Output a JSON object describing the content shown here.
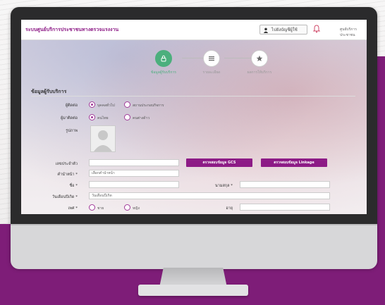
{
  "header": {
    "app_title": "ระบบศูนย์บริการประชาชนทางตรวจแรงงาน",
    "user_button": "ไปยังบัญชีผู้ใช้",
    "right_text": "ศูนย์บริการประชาชน"
  },
  "steps": [
    {
      "label": "ข้อมูลผู้รับบริการ",
      "icon": "lock-icon",
      "state": "active"
    },
    {
      "label": "รายละเอียด",
      "icon": "list-icon",
      "state": "inactive"
    },
    {
      "label": "ผลการให้บริการ",
      "icon": "star-icon",
      "state": "inactive"
    }
  ],
  "form": {
    "section_title": "ข้อมูลผู้รับบริการ",
    "row1": {
      "label": "ผู้ติดต่อ",
      "opt1": "บุคคลทั่วไป",
      "opt2": "สถานประกอบกิจการ"
    },
    "row2": {
      "label": "ผู้มาติดต่อ",
      "opt1": "คนไทย",
      "opt2": "คนต่างด้าว"
    },
    "photo_label": "รูปภาพ",
    "id_label": "เลขประจำตัว",
    "btn_gcs": "ตรวจสอบข้อมูล GCS",
    "btn_linkage": "ตรวจสอบข้อมูล Linkage",
    "prefix_label": "คำนำหน้า *",
    "prefix_value": "เลือกคำนำหน้า",
    "name_label": "ชื่อ *",
    "lastname_label": "นามสกุล *",
    "dob_label": "วันเดือนปีเกิด *",
    "dob_value": "วันเดือนปีเกิด",
    "gender_label": "เพศ *",
    "gender_opt1": "ชาย",
    "gender_opt2": "หญิง",
    "age_label": "อายุ"
  },
  "colors": {
    "brand": "#8d1b86",
    "step_active": "#4caf7d"
  }
}
